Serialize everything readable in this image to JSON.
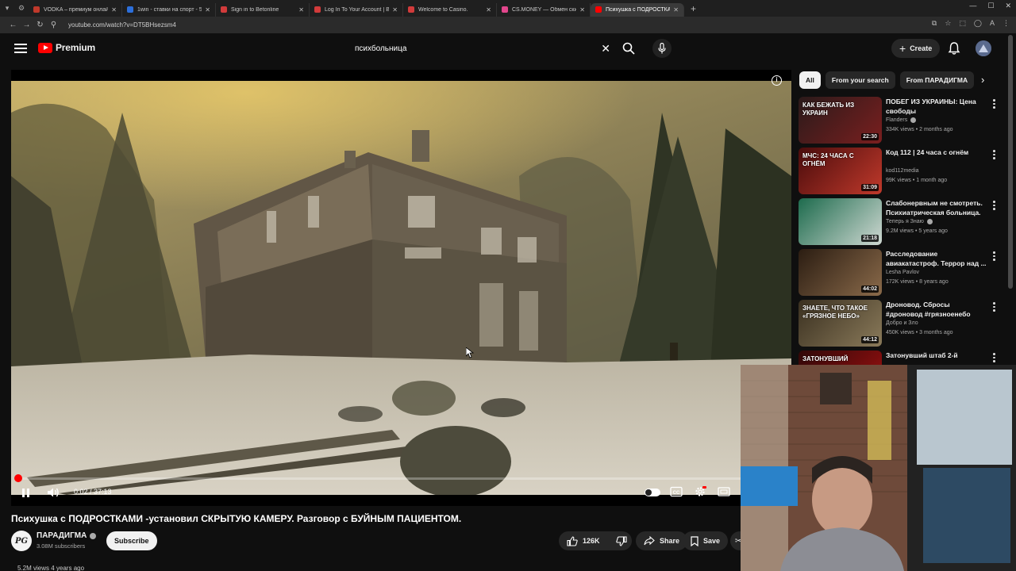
{
  "browser": {
    "tabs": [
      {
        "label": "VODKA – премиум онлайн-ка",
        "color": "#c0392b"
      },
      {
        "label": "1win - ставки на спорт - 57649",
        "color": "#2c6fdb"
      },
      {
        "label": "Sign in to Betonline",
        "color": "#d23b3b"
      },
      {
        "label": "Log In To Your Account | BetO",
        "color": "#d23b3b"
      },
      {
        "label": "Welcome to Casino.",
        "color": "#d23b3b"
      },
      {
        "label": "CS.MONEY — Обмен скинов С",
        "color": "#e2468c"
      },
      {
        "label": "Психушка с ПОДРОСТКАМ",
        "color": "#ff0000"
      }
    ],
    "url": "youtube.com/watch?v=DT5BHsezsm4"
  },
  "header": {
    "logo": "Premium",
    "search_value": "психбольница",
    "create_label": "Create"
  },
  "player": {
    "time": "0:02 / 37:13",
    "progress": 0.001
  },
  "video": {
    "title": "Психушка с ПОДРОСТКАМИ -установил СКРЫТУЮ КАМЕРУ. Разговор с БУЙНЫМ ПАЦИЕНТОМ.",
    "channel": "ПАРАДИГМА",
    "channel_initials": "PG",
    "subscribers": "3.08M subscribers",
    "subscribe_label": "Subscribe",
    "likes": "126K",
    "share_label": "Share",
    "save_label": "Save",
    "views_line": "5.2M views  4 years ago"
  },
  "sidebar": {
    "chips": [
      "All",
      "From your search",
      "From ПАРАДИГМА"
    ],
    "recs": [
      {
        "title": "ПОБЕГ ИЗ УКРАИНЫ: Цена свободы",
        "channel": "Flanders",
        "verified": true,
        "meta": "334K views • 2 months ago",
        "duration": "22:30",
        "thumb_a": "#2a1a1a",
        "thumb_b": "#7a1f1f",
        "overlay": "КАК БЕЖАТЬ ИЗ УКРАИН"
      },
      {
        "title": "Код 112 | 24 часа с огнём",
        "channel": "kod112media",
        "verified": false,
        "meta": "99K views • 1 month ago",
        "duration": "31:09",
        "thumb_a": "#4a0c0c",
        "thumb_b": "#c0392b",
        "overlay": "МЧС: 24 ЧАСА С ОГНЁМ"
      },
      {
        "title": "Слабонервным не смотреть. Психиатрическая больница. ...",
        "channel": "Теперь я Знаю",
        "verified": true,
        "meta": "9.2M views • 5 years ago",
        "duration": "21:18",
        "thumb_a": "#1d6b4d",
        "thumb_b": "#cfd8d2",
        "overlay": ""
      },
      {
        "title": "Расследование авиакатастроф. Террор над ...",
        "channel": "Lesha Pavlov",
        "verified": false,
        "meta": "172K views • 8 years ago",
        "duration": "44:02",
        "thumb_a": "#2b1d12",
        "thumb_b": "#8a6a4a",
        "overlay": ""
      },
      {
        "title": "Дроновод. Сбросы #дроновод #грязноенебо #сбросы ...",
        "channel": "Добро и Зло",
        "verified": false,
        "meta": "450K views • 3 months ago",
        "duration": "44:12",
        "thumb_a": "#3a3020",
        "thumb_b": "#8a7a5a",
        "overlay": "ЗНАЕТЕ, ЧТО ТАКОЕ «ГРЯЗНОЕ НЕБО»"
      },
      {
        "title": "Затонувший штаб 2-й",
        "channel": "",
        "verified": false,
        "meta": "",
        "duration": "",
        "thumb_a": "#300808",
        "thumb_b": "#a01010",
        "overlay": "ЗАТОНУВШИЙ"
      }
    ]
  }
}
